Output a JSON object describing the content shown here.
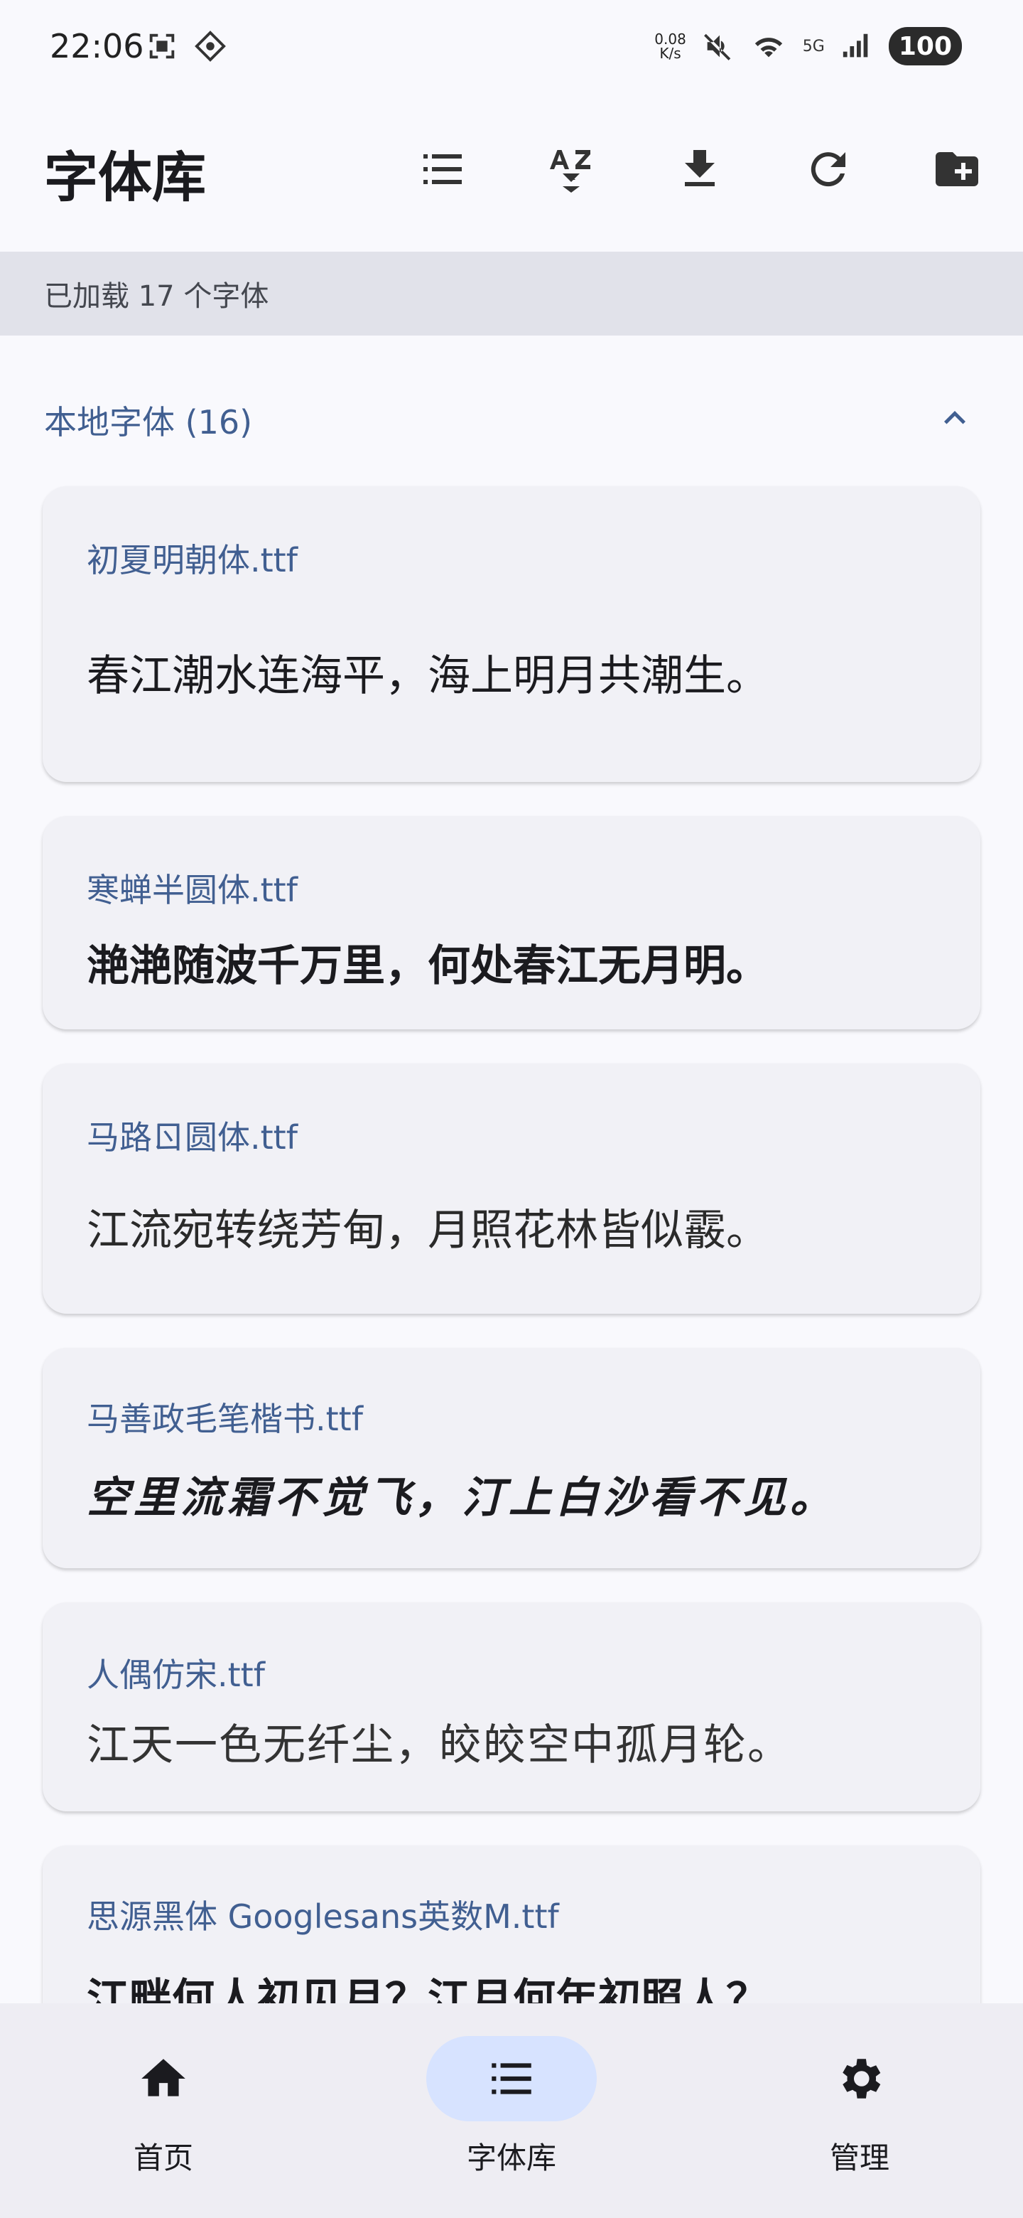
{
  "status_bar": {
    "time": "22:06",
    "net_speed_value": "0.08",
    "net_speed_unit": "K/s",
    "network": "5G",
    "battery": "100"
  },
  "app_bar": {
    "title": "字体库",
    "actions": [
      "list-icon",
      "sort-az-icon",
      "download-icon",
      "refresh-icon",
      "add-folder-icon"
    ]
  },
  "banner": {
    "text": "已加载 17 个字体"
  },
  "section": {
    "title": "本地字体 (16)",
    "expanded": true
  },
  "fonts": [
    {
      "name": "初夏明朝体.ttf",
      "sample": "春江潮水连海平，海上明月共潮生。"
    },
    {
      "name": "寒蝉半圆体.ttf",
      "sample": "滟滟随波千万里，何处春江无月明。"
    },
    {
      "name": "马路ㄖ圆体.ttf",
      "sample": "江流宛转绕芳甸，月照花林皆似霰。"
    },
    {
      "name": "马善政毛笔楷书.ttf",
      "sample": "空里流霜不觉飞，汀上白沙看不见。"
    },
    {
      "name": "人偶仿宋.ttf",
      "sample": "江天一色无纤尘，皎皎空中孤月轮。"
    },
    {
      "name": "思源黑体 Googlesans英数M.ttf",
      "sample": "江畔何人初见月？江月何年初照人？"
    }
  ],
  "bottom_nav": {
    "items": [
      {
        "label": "首页",
        "icon": "home-icon",
        "active": false
      },
      {
        "label": "字体库",
        "icon": "list-icon",
        "active": true
      },
      {
        "label": "管理",
        "icon": "gear-icon",
        "active": false
      }
    ]
  },
  "colors": {
    "accent": "#415f91",
    "banner_bg": "#e1e2ea",
    "card_bg": "#f1f1f6",
    "nav_active": "#d7e3ff",
    "background": "#f9f9fd"
  }
}
